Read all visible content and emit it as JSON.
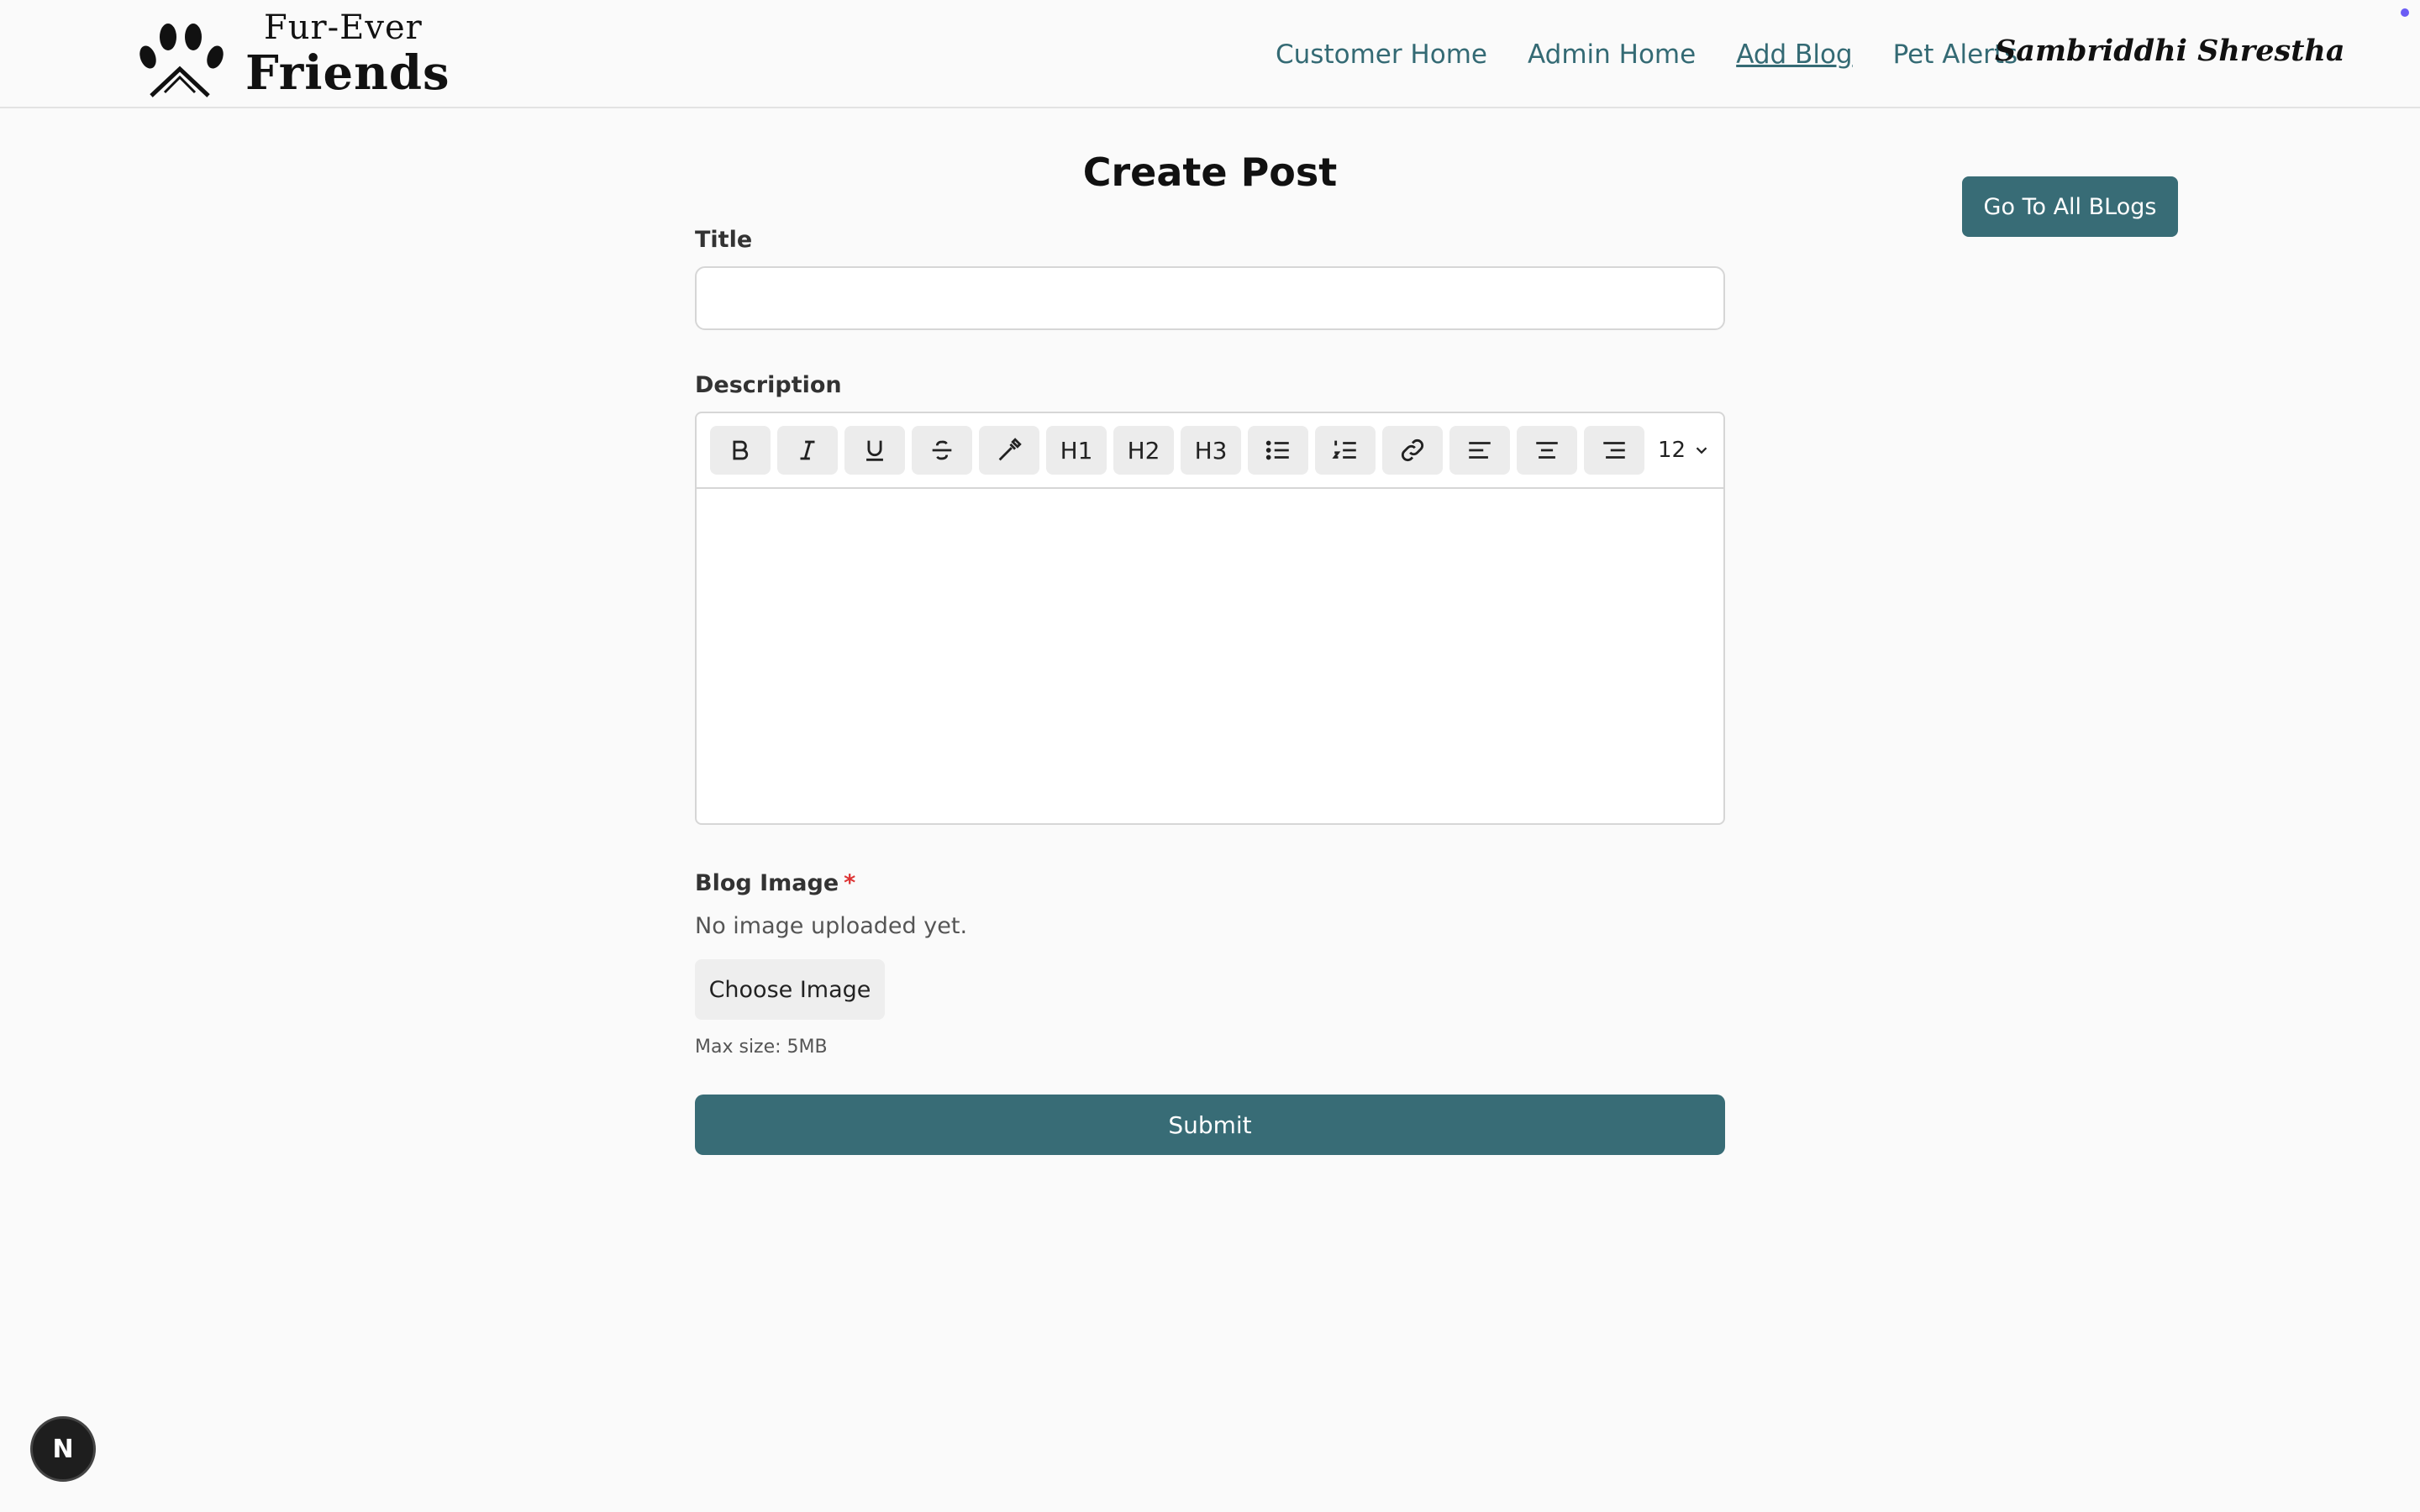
{
  "brand": {
    "line1": "Fur-Ever",
    "line2": "Friends"
  },
  "nav": {
    "items": [
      {
        "label": "Customer Home"
      },
      {
        "label": "Admin Home"
      },
      {
        "label": "Add Blog",
        "active": true
      },
      {
        "label": "Pet Alerts"
      }
    ],
    "user_name": "Sambriddhi Shrestha"
  },
  "page": {
    "title": "Create Post",
    "all_blogs_label": "Go To All BLogs"
  },
  "form": {
    "title_label": "Title",
    "title_value": "",
    "description_label": "Description",
    "toolbar": {
      "buttons": [
        "bold-icon",
        "italic-icon",
        "underline-icon",
        "strikethrough-icon",
        "color-picker-icon",
        "H1",
        "H2",
        "H3",
        "bullet-list-icon",
        "numbered-list-icon",
        "link-icon",
        "align-left-icon",
        "align-center-icon",
        "align-right-icon"
      ],
      "font_size": "12"
    },
    "image_label": "Blog Image",
    "image_required": "*",
    "no_image_text": "No image uploaded yet.",
    "choose_image_label": "Choose Image",
    "max_size_text": "Max size: 5MB",
    "submit_label": "Submit"
  },
  "colors": {
    "accent": "#386c76",
    "link": "#346a74",
    "background": "#fafafa"
  },
  "dev_badge": "N"
}
